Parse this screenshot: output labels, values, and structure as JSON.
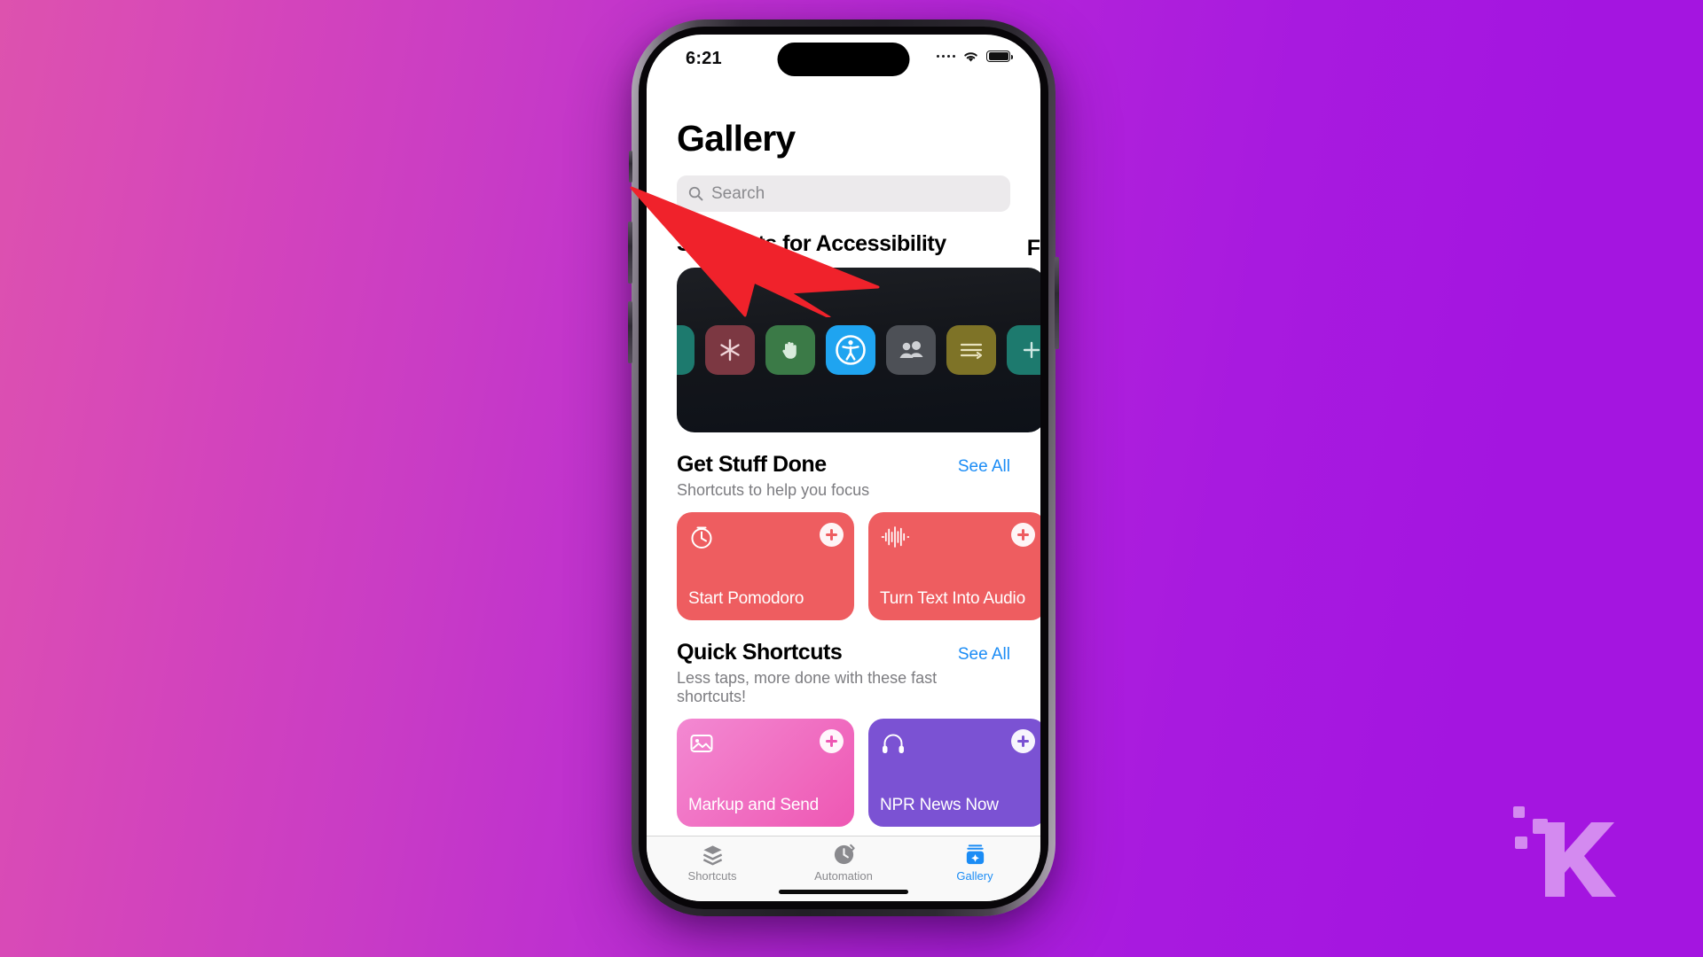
{
  "background": {
    "gradient_from": "#dd52ae",
    "gradient_to": "#a415e0"
  },
  "statusbar": {
    "time": "6:21",
    "signal_icon": "cellular-signal-icon",
    "wifi_icon": "wifi-icon",
    "battery_icon": "battery-icon"
  },
  "app": {
    "page_title": "Gallery",
    "search": {
      "placeholder": "Search",
      "value": "",
      "icon": "search-icon"
    },
    "sections": [
      {
        "title": "Shortcuts for Accessibility",
        "subtitle": "",
        "see_all": "",
        "type": "banner",
        "next_title_peek": "F",
        "icons": [
          {
            "name": "droplet-icon",
            "color": "#1d7a6e"
          },
          {
            "name": "asterisk-icon",
            "color": "#7c3842"
          },
          {
            "name": "hand-raised-icon",
            "color": "#3b7a47"
          },
          {
            "name": "accessibility-icon",
            "color": "#1fa4f0"
          },
          {
            "name": "people-icon",
            "color": "#4d5056"
          },
          {
            "name": "sliders-icon",
            "color": "#7e7327"
          },
          {
            "name": "plus-tile-icon",
            "color": "#1d7a6e"
          }
        ]
      },
      {
        "title": "Get Stuff Done",
        "subtitle": "Shortcuts to help you focus",
        "see_all": "See All",
        "type": "cards",
        "cards": [
          {
            "label": "Start Pomodoro",
            "color": "#ee5d60",
            "glyph": "timer-icon",
            "add": "add-icon"
          },
          {
            "label": "Turn Text Into Audio",
            "color": "#ee5d60",
            "glyph": "waveform-icon",
            "add": "add-icon"
          },
          {
            "label": "",
            "color": "#34aaf2",
            "glyph": "",
            "add": ""
          }
        ]
      },
      {
        "title": "Quick Shortcuts",
        "subtitle": "Less taps, more done with these fast shortcuts!",
        "see_all": "See All",
        "type": "cards",
        "cards": [
          {
            "label": "Markup and Send",
            "color": "#f06ac0",
            "glyph": "photo-icon",
            "add": "add-icon"
          },
          {
            "label": "NPR News Now",
            "color": "#7b52d3",
            "glyph": "headphones-icon",
            "add": "add-icon"
          },
          {
            "label": "",
            "color": "#ee5d60",
            "glyph": "",
            "add": ""
          }
        ]
      }
    ],
    "tabbar": [
      {
        "label": "Shortcuts",
        "icon": "stack-icon",
        "active": false
      },
      {
        "label": "Automation",
        "icon": "clock-arrow-icon",
        "active": false
      },
      {
        "label": "Gallery",
        "icon": "gallery-badge-icon",
        "active": true
      }
    ],
    "accent_color": "#1b8cf5"
  },
  "annotation": {
    "arrow": {
      "name": "red-arrow-pointer",
      "color": "#f0222b"
    }
  },
  "watermark": {
    "name": "knowtechie-logo",
    "letter": "K",
    "color": "#e7b7f7"
  }
}
